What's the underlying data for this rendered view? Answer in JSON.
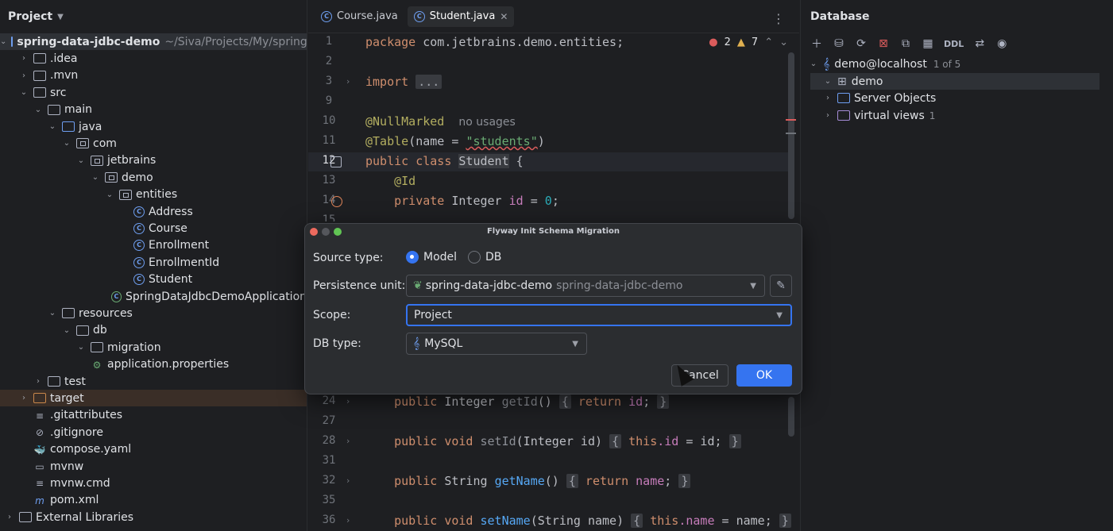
{
  "project": {
    "title": "Project",
    "tree": [
      {
        "label": "spring-data-jdbc-demo",
        "suffix": "~/Siva/Projects/My/spring-d",
        "depth": 0,
        "icon": "module-folder",
        "expand": "open",
        "bold": true
      },
      {
        "label": ".idea",
        "depth": 1,
        "icon": "folder",
        "expand": "closed"
      },
      {
        "label": ".mvn",
        "depth": 1,
        "icon": "folder",
        "expand": "closed"
      },
      {
        "label": "src",
        "depth": 1,
        "icon": "folder",
        "expand": "open"
      },
      {
        "label": "main",
        "depth": 2,
        "icon": "folder",
        "expand": "open"
      },
      {
        "label": "java",
        "depth": 3,
        "icon": "source-folder",
        "expand": "open"
      },
      {
        "label": "com",
        "depth": 4,
        "icon": "package",
        "expand": "open"
      },
      {
        "label": "jetbrains",
        "depth": 5,
        "icon": "package",
        "expand": "open"
      },
      {
        "label": "demo",
        "depth": 6,
        "icon": "package",
        "expand": "open"
      },
      {
        "label": "entities",
        "depth": 7,
        "icon": "package",
        "expand": "open"
      },
      {
        "label": "Address",
        "depth": 8,
        "icon": "class"
      },
      {
        "label": "Course",
        "depth": 8,
        "icon": "class"
      },
      {
        "label": "Enrollment",
        "depth": 8,
        "icon": "class"
      },
      {
        "label": "EnrollmentId",
        "depth": 8,
        "icon": "class"
      },
      {
        "label": "Student",
        "depth": 8,
        "icon": "class"
      },
      {
        "label": "SpringDataJdbcDemoApplication",
        "depth": 7,
        "icon": "spring-class"
      },
      {
        "label": "resources",
        "depth": 3,
        "icon": "resources-folder",
        "expand": "open"
      },
      {
        "label": "db",
        "depth": 4,
        "icon": "folder",
        "expand": "open"
      },
      {
        "label": "migration",
        "depth": 5,
        "icon": "folder",
        "expand": "open"
      },
      {
        "label": "application.properties",
        "depth": 5,
        "icon": "properties-file"
      },
      {
        "label": "test",
        "depth": 2,
        "icon": "folder",
        "expand": "closed"
      },
      {
        "label": "target",
        "depth": 1,
        "icon": "excluded-folder",
        "expand": "closed",
        "highlight": true
      },
      {
        "label": ".gitattributes",
        "depth": 1,
        "icon": "text-file"
      },
      {
        "label": ".gitignore",
        "depth": 1,
        "icon": "ignore-file"
      },
      {
        "label": "compose.yaml",
        "depth": 1,
        "icon": "docker-file"
      },
      {
        "label": "mvnw",
        "depth": 1,
        "icon": "shell-file"
      },
      {
        "label": "mvnw.cmd",
        "depth": 1,
        "icon": "text-file"
      },
      {
        "label": "pom.xml",
        "depth": 1,
        "icon": "maven-file"
      },
      {
        "label": "External Libraries",
        "depth": 0,
        "icon": "libraries",
        "expand": "closed"
      }
    ]
  },
  "editor": {
    "tabs": [
      {
        "label": "Course.java",
        "active": false
      },
      {
        "label": "Student.java",
        "active": true
      }
    ],
    "errors": "2",
    "warnings": "7",
    "top_lines": [
      {
        "n": "1"
      },
      {
        "n": "2"
      },
      {
        "n": "3"
      },
      {
        "n": "9"
      },
      {
        "n": "10"
      },
      {
        "n": "11"
      },
      {
        "n": "12"
      },
      {
        "n": "13"
      },
      {
        "n": "14"
      },
      {
        "n": "15"
      }
    ],
    "code": {
      "l1_kw": "package",
      "l1_rest": " com.jetbrains.demo.entities;",
      "l3_kw": "import",
      "l3_fold": "...",
      "l10_ann": "@NullMarked",
      "l10_usage": "no usages",
      "l11_ann": "@Table",
      "l11_a": "(name = ",
      "l11_str": "\"students\"",
      "l11_b": ")",
      "l12_kw": "public class ",
      "l12_cls": "Student",
      "l12_b": " {",
      "l13_ann": "@Id",
      "l14_kw": "private",
      "l14_a": " Integer ",
      "l14_fld": "id",
      "l14_b": " = ",
      "l14_num": "0",
      "l14_c": ";",
      "l24_kw": "public",
      "l24_a": " Integer ",
      "l24_fn": "getId",
      "l24_b": "() ",
      "l24_f1": "{",
      "l24_kw2": " return",
      "l24_fld": " id",
      "l24_c": ";",
      "l24_f2": "}",
      "l28_kw": "public void",
      "l28_fn": " setId",
      "l28_a": "(Integer id) ",
      "l28_f1": "{",
      "l28_kw2": " this",
      "l28_fld": ".id",
      "l28_b": " = id;",
      "l28_f2": "}",
      "l32_kw": "public",
      "l32_a": " String ",
      "l32_fn": "getName",
      "l32_b": "() ",
      "l32_f1": "{",
      "l32_kw2": " return",
      "l32_fld": " name",
      "l32_c": ";",
      "l32_f2": "}",
      "l36_kw": "public void",
      "l36_fn": " setName",
      "l36_a": "(String name) ",
      "l36_f1": "{",
      "l36_kw2": " this",
      "l36_fld": ".name",
      "l36_b": " = name;",
      "l36_f2": "}"
    },
    "bottom_lines": [
      "24",
      "27",
      "28",
      "31",
      "32",
      "35",
      "36"
    ]
  },
  "database": {
    "title": "Database",
    "toolbar_ddl": "DDL",
    "tree": {
      "host": "demo@localhost",
      "host_count": "1 of 5",
      "schema": "demo",
      "server_objects": "Server Objects",
      "virtual_views": "virtual views",
      "virtual_views_count": "1"
    }
  },
  "dialog": {
    "title": "Flyway Init Schema Migration",
    "source_type_label": "Source type:",
    "source_model": "Model",
    "source_db": "DB",
    "persistence_label": "Persistence unit:",
    "persistence_value": "spring-data-jdbc-demo",
    "persistence_hint": "spring-data-jdbc-demo",
    "scope_label": "Scope:",
    "scope_value": "Project",
    "dbtype_label": "DB type:",
    "dbtype_value": "MySQL",
    "cancel": "Cancel",
    "ok": "OK"
  },
  "colors": {
    "accent": "#3574f0",
    "error": "#db5c5c",
    "warning": "#e0b050",
    "background": "#1e1f22"
  }
}
